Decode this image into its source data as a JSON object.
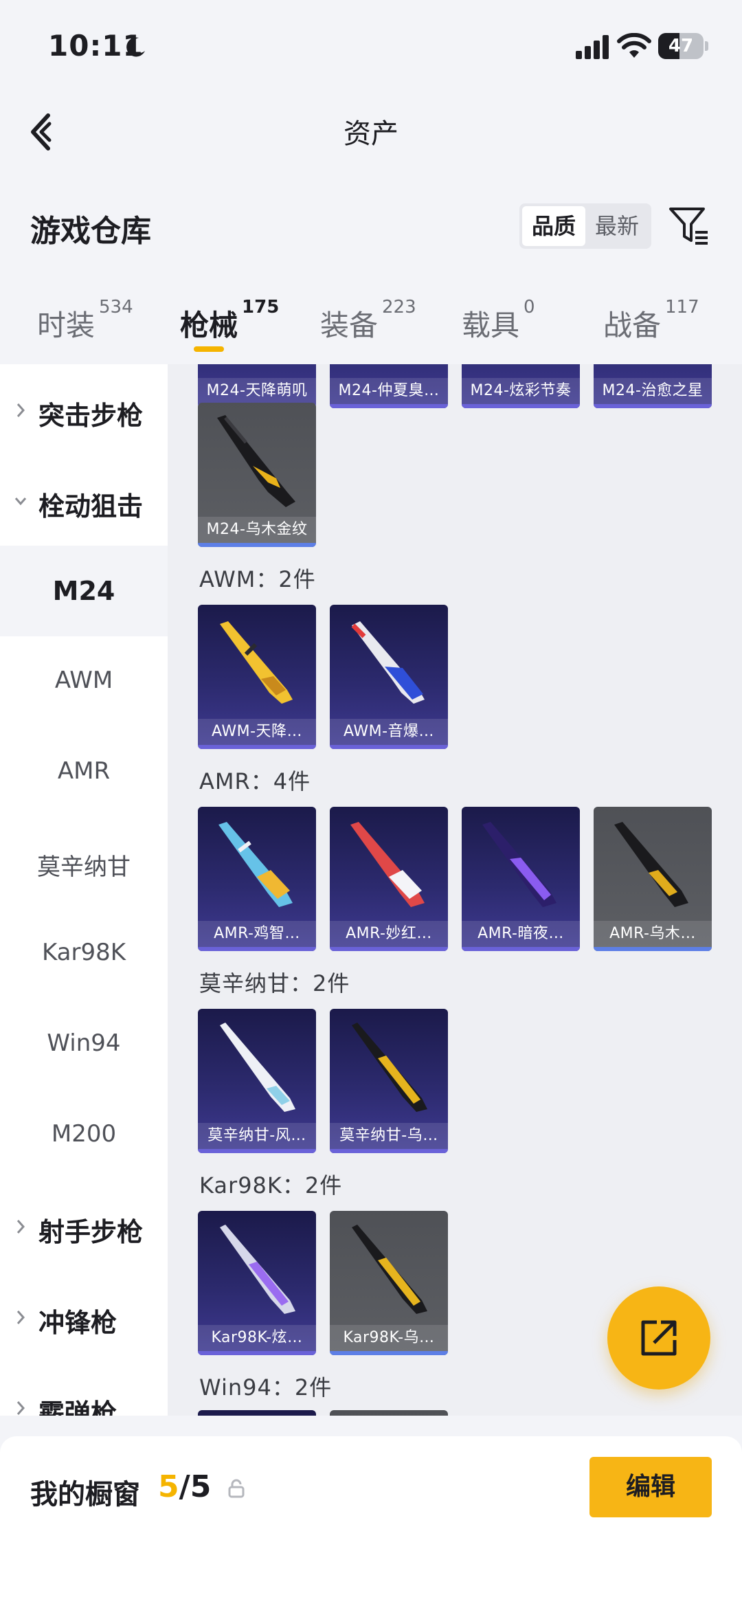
{
  "status_bar": {
    "time": "10:11",
    "battery": "47",
    "battery_level": 0.47
  },
  "header": {
    "title": "资产"
  },
  "section": {
    "title": "游戏仓库",
    "sort_options": [
      "品质",
      "最新"
    ],
    "sort_active": "品质"
  },
  "tabs": [
    {
      "label": "时装",
      "count": "534"
    },
    {
      "label": "枪械",
      "count": "175",
      "active": true
    },
    {
      "label": "装备",
      "count": "223"
    },
    {
      "label": "载具",
      "count": "0"
    },
    {
      "label": "战备",
      "count": "117"
    }
  ],
  "sidebar": {
    "items": [
      {
        "label": "突击步枪",
        "type": "group",
        "expanded": false
      },
      {
        "label": "栓动狙击",
        "type": "group",
        "expanded": true
      },
      {
        "label": "M24",
        "type": "sub",
        "active": true
      },
      {
        "label": "AWM",
        "type": "sub"
      },
      {
        "label": "AMR",
        "type": "sub"
      },
      {
        "label": "莫辛纳甘",
        "type": "sub"
      },
      {
        "label": "Kar98K",
        "type": "sub"
      },
      {
        "label": "Win94",
        "type": "sub"
      },
      {
        "label": "M200",
        "type": "sub"
      },
      {
        "label": "射手步枪",
        "type": "group",
        "expanded": false
      },
      {
        "label": "冲锋枪",
        "type": "group",
        "expanded": false
      },
      {
        "label": "霰弹枪",
        "type": "group",
        "expanded": false
      }
    ]
  },
  "groups": {
    "m24": {
      "items": [
        {
          "name": "M24-天降萌叽",
          "style": "purple"
        },
        {
          "name": "M24-仲夏臭…",
          "style": "purple"
        },
        {
          "name": "M24-炫彩节奏",
          "style": "purple"
        },
        {
          "name": "M24-治愈之星",
          "style": "purple"
        },
        {
          "name": "M24-乌木金纹",
          "style": "grey"
        }
      ]
    },
    "awm": {
      "label": "AWM：2件",
      "items": [
        {
          "name": "AWM-天降…",
          "style": "purple"
        },
        {
          "name": "AWM-音爆…",
          "style": "purple"
        }
      ]
    },
    "amr": {
      "label": "AMR：4件",
      "items": [
        {
          "name": "AMR-鸡智…",
          "style": "purple"
        },
        {
          "name": "AMR-妙红…",
          "style": "purple"
        },
        {
          "name": "AMR-暗夜…",
          "style": "purple"
        },
        {
          "name": "AMR-乌木…",
          "style": "grey"
        }
      ]
    },
    "mosin": {
      "label": "莫辛纳甘：2件",
      "items": [
        {
          "name": "莫辛纳甘-风…",
          "style": "purple"
        },
        {
          "name": "莫辛纳甘-乌…",
          "style": "purple"
        }
      ]
    },
    "kar98k": {
      "label": "Kar98K：2件",
      "items": [
        {
          "name": "Kar98K-炫…",
          "style": "purple"
        },
        {
          "name": "Kar98K-乌…",
          "style": "grey"
        }
      ]
    },
    "win94": {
      "label": "Win94：2件"
    }
  },
  "showcase": {
    "label": "我的橱窗",
    "current": "5",
    "total": "/5",
    "edit_label": "编辑"
  },
  "colors": {
    "accent": "#f5b400",
    "card_purple": "#2c2a6e",
    "card_grey": "#5d5f64"
  }
}
